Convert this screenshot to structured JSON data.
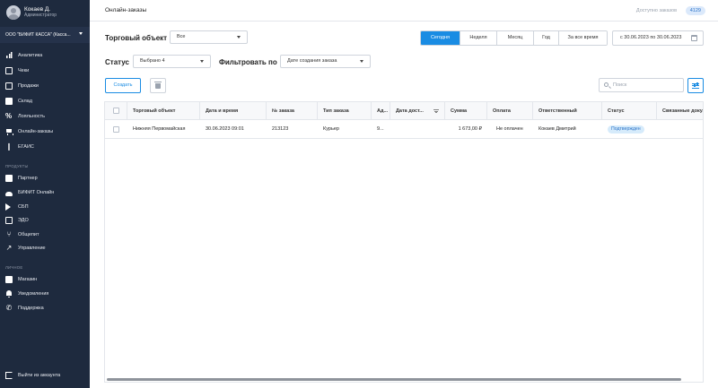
{
  "sidebar": {
    "user": {
      "name": "Кокаев Д.",
      "role": "Администратор"
    },
    "org": "ООО \"БИФИТ КАССА\" (Касса...",
    "items": [
      {
        "label": "Аналитика",
        "icon": "bar-chart-icon"
      },
      {
        "label": "Чеки",
        "icon": "receipt-icon"
      },
      {
        "label": "Продажи",
        "icon": "document-icon"
      },
      {
        "label": "Склад",
        "icon": "box-icon"
      },
      {
        "label": "Лояльность",
        "icon": "percent-icon"
      },
      {
        "label": "Онлайн-заказы",
        "icon": "cart-icon"
      },
      {
        "label": "ЕГАИС",
        "icon": "bottle-icon"
      }
    ],
    "products_label": "ПРОДУКТЫ",
    "products": [
      {
        "label": "Партнер",
        "icon": "briefcase-icon"
      },
      {
        "label": "БИФИТ Онлайн",
        "icon": "cloud-icon"
      },
      {
        "label": "СБП",
        "icon": "sbp-icon"
      },
      {
        "label": "ЭДО",
        "icon": "edo-icon"
      },
      {
        "label": "Общепит",
        "icon": "cutlery-icon"
      },
      {
        "label": "Управление",
        "icon": "chart-up-icon"
      }
    ],
    "personal_label": "ЛИЧНОЕ",
    "personal": [
      {
        "label": "Магазин",
        "icon": "store-icon"
      },
      {
        "label": "Уведомления",
        "icon": "bell-icon"
      },
      {
        "label": "Поддержка",
        "icon": "phone-icon"
      }
    ],
    "logout": "Выйти из аккаунта"
  },
  "header": {
    "title": "Онлайн-заказы",
    "available_label": "Доступно заказов",
    "available_count": "4129"
  },
  "filters": {
    "trade_object_label": "Торговый объект",
    "trade_object_value": "Все",
    "status_label": "Статус",
    "status_value": "Выбрано 4",
    "filter_by_label": "Фильтровать по",
    "filter_by_value": "Дате создания заказа",
    "periods": [
      "Сегодня",
      "Неделя",
      "Месяц",
      "Год",
      "За все время"
    ],
    "active_period": "Сегодня",
    "date_range": "с 30.06.2023  по 30.06.2023"
  },
  "actions": {
    "create_label": "Создать",
    "search_placeholder": "Поиск"
  },
  "table": {
    "columns": [
      "Торговый объект",
      "Дата и время",
      "№ заказа",
      "Тип заказа",
      "Ад...",
      "Дата дост...",
      "Сумма",
      "Оплата",
      "Ответственный",
      "Статус",
      "Связанные доку..."
    ],
    "rows": [
      {
        "trade_object": "Нижняя Первомайская",
        "datetime": "30.06.2023 09:01",
        "order_no": "213123",
        "order_type": "Курьер",
        "address": "9...",
        "delivery_date": "",
        "sum": "1 673,00 ₽",
        "payment": "Не оплачен",
        "responsible": "Кокаев Дмитрий",
        "status": "Подтвержден",
        "docs": ""
      }
    ]
  },
  "colors": {
    "sidebar_bg": "#1e2a3e",
    "accent": "#1a8ce3",
    "status_pill_bg": "#d6ebfb"
  }
}
